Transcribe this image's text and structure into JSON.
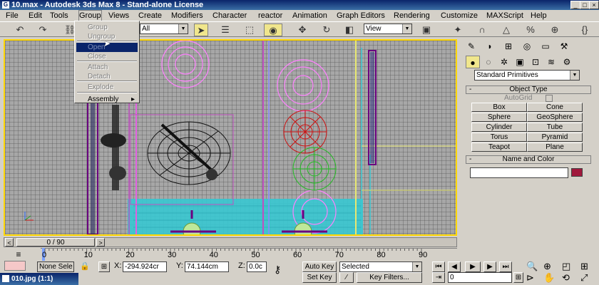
{
  "window": {
    "title": "10.max - Autodesk 3ds Max 8 - Stand-alone License",
    "icon": "max-logo-icon"
  },
  "menubar": {
    "items": [
      "File",
      "Edit",
      "Tools",
      "Group",
      "Views",
      "Create",
      "Modifiers",
      "Character",
      "reactor",
      "Animation",
      "Graph Editors",
      "Rendering",
      "Customize",
      "MAXScript",
      "Help"
    ],
    "active": "Group"
  },
  "toolbar": {
    "selection_filter": "All",
    "ref_coord": "View"
  },
  "group_menu": {
    "items": [
      {
        "label": "Group",
        "state": "disabled"
      },
      {
        "label": "Ungroup",
        "state": "disabled"
      },
      {
        "label": "Open",
        "state": "highlight"
      },
      {
        "label": "Close",
        "state": "disabled"
      },
      {
        "label": "Attach",
        "state": "disabled"
      },
      {
        "label": "Detach",
        "state": "disabled"
      },
      {
        "label": "Explode",
        "state": "disabled"
      },
      {
        "label": "Assembly",
        "state": "normal",
        "submenu": "▸"
      }
    ]
  },
  "command_panel": {
    "category": "Standard Primitives",
    "object_type": {
      "title": "Object Type",
      "sign": "-",
      "autogrid": "AutoGrid"
    },
    "primitives": [
      "Box",
      "Cone",
      "Sphere",
      "GeoSphere",
      "Cylinder",
      "Tube",
      "Torus",
      "Pyramid",
      "Teapot",
      "Plane"
    ],
    "name_color": {
      "title": "Name and Color",
      "sign": "-",
      "name": "",
      "color": "#a0183c"
    }
  },
  "timeslider": {
    "label": "0 / 90",
    "left_arrow": "<",
    "right_arrow": ">"
  },
  "ruler": {
    "ticks": [
      "0",
      "10",
      "20",
      "30",
      "40",
      "50",
      "60",
      "70",
      "80",
      "90"
    ]
  },
  "status": {
    "selected_text": "None Sele",
    "x_label": "X:",
    "x_value": "-294.924cr",
    "y_label": "Y:",
    "y_value": "74.144cm",
    "z_label": "Z:",
    "z_value": "0.0c",
    "auto_key": "Auto Key",
    "set_key": "Set Key",
    "key_mode": "Selected",
    "key_filters": "Key Filters...",
    "frame": "0"
  },
  "taskbar": {
    "item": "010.jpg (1:1)"
  }
}
